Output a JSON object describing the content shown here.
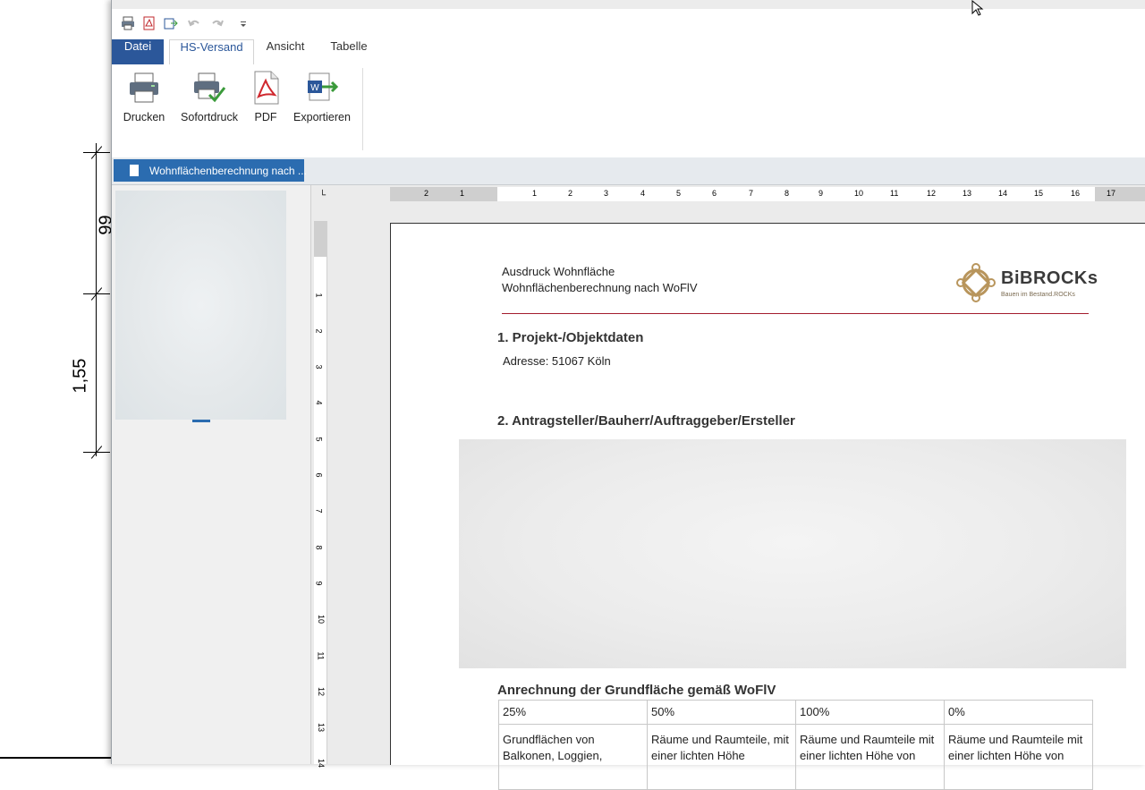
{
  "background_drawing": {
    "dimension_label_lower": "1,55",
    "dimension_label_upper": "99"
  },
  "quick_access": {
    "icons": [
      "print-icon",
      "pdf-icon",
      "export-icon",
      "undo-icon",
      "redo-icon",
      "customize-icon"
    ]
  },
  "tabs": [
    {
      "label": "Datei"
    },
    {
      "label": "HS-Versand"
    },
    {
      "label": "Ansicht"
    },
    {
      "label": "Tabelle"
    }
  ],
  "ribbon": {
    "buttons": [
      {
        "label": "Drucken",
        "icon": "printer-icon"
      },
      {
        "label": "Sofortdruck",
        "icon": "quick-print-icon"
      },
      {
        "label": "PDF",
        "icon": "pdf-document-icon"
      },
      {
        "label": "Exportieren",
        "icon": "word-export-icon"
      }
    ]
  },
  "document_tab": {
    "title": "Wohnflächenberechnung nach ..."
  },
  "ruler": {
    "horizontal_labels": [
      "2",
      "1",
      "1",
      "2",
      "3",
      "4",
      "5",
      "6",
      "7",
      "8",
      "9",
      "10",
      "11",
      "12",
      "13",
      "14",
      "15",
      "16",
      "17"
    ],
    "vertical_labels": [
      "1",
      "2",
      "3",
      "4",
      "5",
      "6",
      "7",
      "8",
      "9",
      "10",
      "11",
      "12",
      "13",
      "14"
    ]
  },
  "document": {
    "header_line1": "Ausdruck Wohnfläche",
    "header_line2": "Wohnflächenberechnung nach WoFlV",
    "logo_text": "BiBROCKs",
    "logo_tagline": "Bauen im Bestand.ROCKs",
    "section1_title": "1. Projekt-/Objektdaten",
    "address": "Adresse: 51067 Köln",
    "section2_title": "2. Antragsteller/Bauherr/Auftraggeber/Ersteller",
    "anrechnung_title": "Anrechnung der Grundfläche gemäß WoFlV",
    "table": {
      "headers": [
        "25%",
        "50%",
        "100%",
        "0%"
      ],
      "row1": [
        "Grundflächen von Balkonen, Loggien,",
        "Räume und Raumteile, mit einer lichten Höhe",
        "Räume und Raumteile mit einer lichten Höhe von",
        "Räume und Raumteile mit einer lichten Höhe von"
      ]
    }
  },
  "colors": {
    "datei_tab": "#2b579a",
    "active_tab_text": "#2b579a",
    "document_tab_bg": "#2b6cb0",
    "header_rule": "#a31d2e",
    "logo_gold": "#b8955c"
  }
}
